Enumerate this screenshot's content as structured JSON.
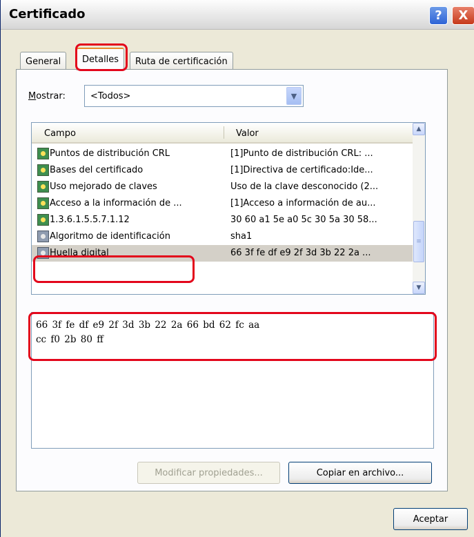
{
  "window": {
    "title": "Certificado",
    "help_glyph": "?",
    "close_glyph": "X"
  },
  "tabs": [
    {
      "label": "General",
      "active": false
    },
    {
      "label": "Detalles",
      "active": true
    },
    {
      "label": "Ruta de certificación",
      "active": false
    }
  ],
  "show": {
    "label": "Mostrar:",
    "value": "<Todos>"
  },
  "list": {
    "columns": [
      "Campo",
      "Valor"
    ],
    "rows": [
      {
        "field": "Puntos de distribución CRL",
        "value": "[1]Punto de distribución CRL: ...",
        "icon": "cert-extension-icon"
      },
      {
        "field": "Bases del certificado",
        "value": "[1]Directiva de certificado:Ide...",
        "icon": "cert-extension-icon"
      },
      {
        "field": "Uso mejorado de claves",
        "value": "Uso de la clave desconocido (2...",
        "icon": "cert-extension-icon"
      },
      {
        "field": "Acceso a la información de ...",
        "value": "[1]Acceso a información de au...",
        "icon": "cert-extension-icon"
      },
      {
        "field": "1.3.6.1.5.5.7.1.12",
        "value": "30 60 a1 5e a0 5c 30 5a 30 58...",
        "icon": "cert-extension-icon"
      },
      {
        "field": "Algoritmo de identificación",
        "value": "sha1",
        "icon": "cert-property-icon"
      },
      {
        "field": "Huella digital",
        "value": "66 3f fe df e9 2f 3d 3b 22 2a ...",
        "icon": "cert-property-icon",
        "selected": true
      }
    ]
  },
  "detail": {
    "line1": "66 3f fe df e9 2f 3d 3b 22 2a 66 bd 62 fc aa",
    "line2": "cc f0 2b 80 ff"
  },
  "buttons": {
    "edit_properties": "Modificar propiedades...",
    "copy_to_file": "Copiar en archivo...",
    "ok": "Aceptar"
  },
  "colors": {
    "highlight": "#e3061b",
    "tab_accent": "#e68b2c"
  }
}
